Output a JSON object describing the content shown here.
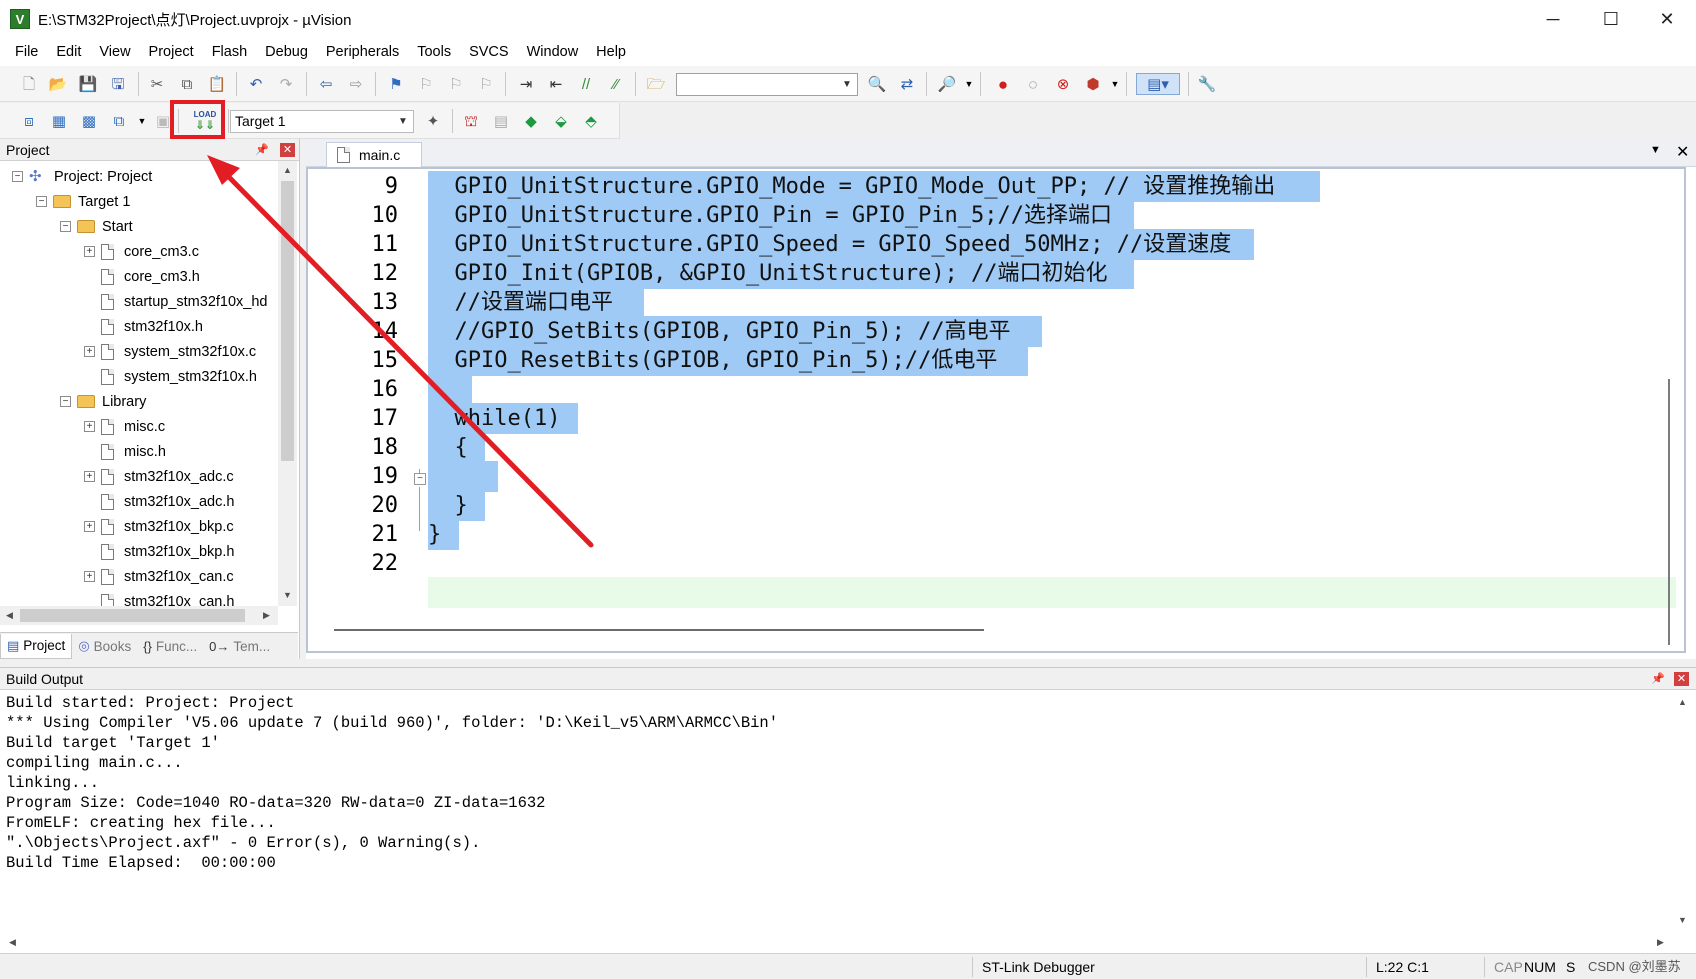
{
  "window": {
    "title": "E:\\STM32Project\\点灯\\Project.uvprojx - µVision",
    "app_icon": "uvision-icon",
    "controls": {
      "minimize": "─",
      "maximize": "☐",
      "close": "✕"
    }
  },
  "menu": {
    "items": [
      "File",
      "Edit",
      "View",
      "Project",
      "Flash",
      "Debug",
      "Peripherals",
      "Tools",
      "SVCS",
      "Window",
      "Help"
    ]
  },
  "toolbar2": {
    "target_select": "Target 1",
    "load_button_label": "LOAD"
  },
  "project_panel": {
    "title": "Project",
    "tree": [
      {
        "label": "Project: Project",
        "level": 0,
        "type": "project",
        "expander": "−"
      },
      {
        "label": "Target 1",
        "level": 1,
        "type": "folder",
        "expander": "−"
      },
      {
        "label": "Start",
        "level": 2,
        "type": "folder",
        "expander": "−"
      },
      {
        "label": "core_cm3.c",
        "level": 3,
        "type": "file",
        "expander": "+"
      },
      {
        "label": "core_cm3.h",
        "level": 3,
        "type": "file",
        "expander": ""
      },
      {
        "label": "startup_stm32f10x_hd",
        "level": 3,
        "type": "file",
        "expander": ""
      },
      {
        "label": "stm32f10x.h",
        "level": 3,
        "type": "file",
        "expander": ""
      },
      {
        "label": "system_stm32f10x.c",
        "level": 3,
        "type": "file",
        "expander": "+"
      },
      {
        "label": "system_stm32f10x.h",
        "level": 3,
        "type": "file",
        "expander": ""
      },
      {
        "label": "Library",
        "level": 2,
        "type": "folder",
        "expander": "−"
      },
      {
        "label": "misc.c",
        "level": 3,
        "type": "file",
        "expander": "+"
      },
      {
        "label": "misc.h",
        "level": 3,
        "type": "file",
        "expander": ""
      },
      {
        "label": "stm32f10x_adc.c",
        "level": 3,
        "type": "file",
        "expander": "+"
      },
      {
        "label": "stm32f10x_adc.h",
        "level": 3,
        "type": "file",
        "expander": ""
      },
      {
        "label": "stm32f10x_bkp.c",
        "level": 3,
        "type": "file",
        "expander": "+"
      },
      {
        "label": "stm32f10x_bkp.h",
        "level": 3,
        "type": "file",
        "expander": ""
      },
      {
        "label": "stm32f10x_can.c",
        "level": 3,
        "type": "file",
        "expander": "+"
      },
      {
        "label": "stm32f10x_can.h",
        "level": 3,
        "type": "file",
        "expander": ""
      }
    ],
    "tabs": [
      {
        "label": "Project",
        "icon": "project-icon",
        "active": true
      },
      {
        "label": "Books",
        "icon": "books-icon",
        "active": false
      },
      {
        "label": "Func...",
        "icon": "functions-icon",
        "active": false
      },
      {
        "label": "Tem...",
        "icon": "templates-icon",
        "active": false
      }
    ]
  },
  "editor": {
    "tab": "main.c",
    "lines": [
      {
        "no": "9",
        "text": "  GPIO_UnitStructure.GPIO_Mode = GPIO_Mode_Out_PP; // 设置推挽输出 ",
        "sel_chars": 67
      },
      {
        "no": "10",
        "text": "  GPIO_UnitStructure.GPIO_Pin = GPIO_Pin_5;//选择端口 ",
        "sel_chars": 53
      },
      {
        "no": "11",
        "text": "  GPIO_UnitStructure.GPIO_Speed = GPIO_Speed_50MHz; //设置速度 ",
        "sel_chars": 62
      },
      {
        "no": "12",
        "text": "  GPIO_Init(GPIOB, &GPIO_UnitStructure); //端口初始化 ",
        "sel_chars": 53
      },
      {
        "no": "13",
        "text": "  //设置端口电平 ",
        "sel_chars": 16
      },
      {
        "no": "14",
        "text": "  //GPIO_SetBits(GPIOB, GPIO_Pin_5); //高电平 ",
        "sel_chars": 46
      },
      {
        "no": "15",
        "text": "  GPIO_ResetBits(GPIOB, GPIO_Pin_5);//低电平 ",
        "sel_chars": 45
      },
      {
        "no": "16",
        "text": "   ",
        "sel_chars": 3
      },
      {
        "no": "17",
        "text": "  while(1) ",
        "sel_chars": 11
      },
      {
        "no": "18",
        "text": "  { ",
        "sel_chars": 4
      },
      {
        "no": "19",
        "text": "     ",
        "sel_chars": 5
      },
      {
        "no": "20",
        "text": "  } ",
        "sel_chars": 4
      },
      {
        "no": "21",
        "text": "} ",
        "sel_chars": 2
      },
      {
        "no": "22",
        "text": "",
        "sel_chars": 0
      }
    ],
    "current_line": "22"
  },
  "build_output": {
    "title": "Build Output",
    "text": "Build started: Project: Project\n*** Using Compiler 'V5.06 update 7 (build 960)', folder: 'D:\\Keil_v5\\ARM\\ARMCC\\Bin'\nBuild target 'Target 1'\ncompiling main.c...\nlinking...\nProgram Size: Code=1040 RO-data=320 RW-data=0 ZI-data=1632\nFromELF: creating hex file...\n\".\\Objects\\Project.axf\" - 0 Error(s), 0 Warning(s).\nBuild Time Elapsed:  00:00:00"
  },
  "status": {
    "debugger": "ST-Link Debugger",
    "position": "L:22 C:1",
    "cap": "CAP",
    "num": "NUM",
    "scrl": "S",
    "watermark": "CSDN @刘墨苏"
  },
  "colors": {
    "selection": "#9fcaf5",
    "current_line": "#e8fbe8",
    "annotation_red": "#e21e24"
  }
}
